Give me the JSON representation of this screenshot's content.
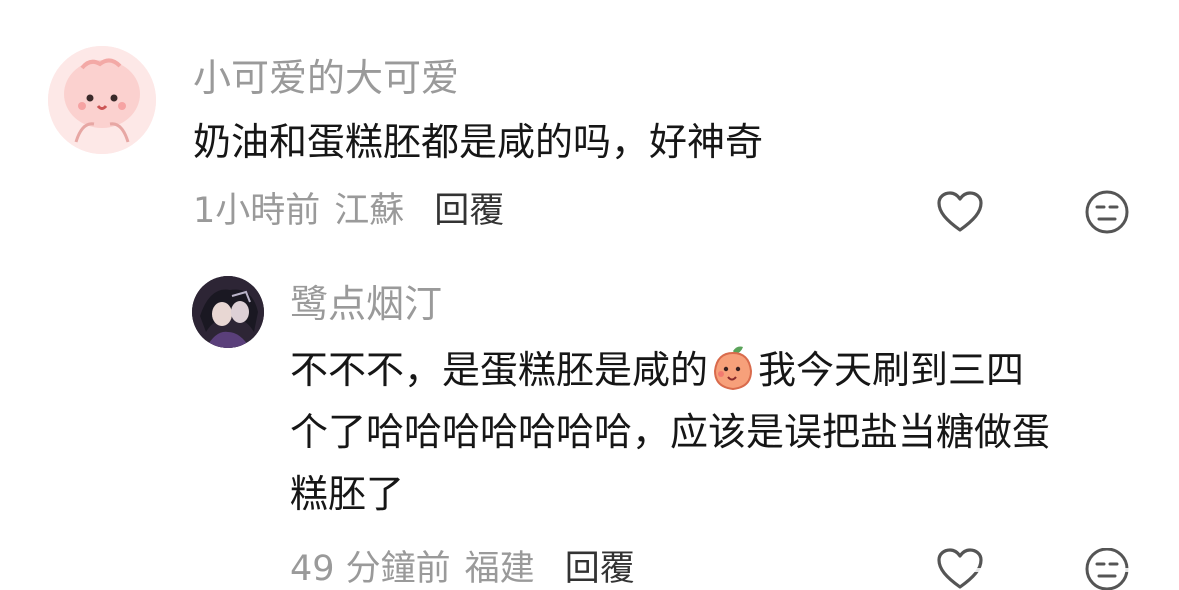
{
  "comments": [
    {
      "username": "小可爱的大可爱",
      "text": "奶油和蛋糕胚都是咸的吗，好神奇",
      "time": "1小時前",
      "location": "江蘇",
      "reply_label": "回覆"
    }
  ],
  "replies": [
    {
      "username": "鹭点烟汀",
      "text_before_emoji": "不不不，是蛋糕胚是咸的",
      "emoji": "peach-emoji",
      "text_after_emoji": "我今天刷到三四",
      "text_line2": "个了哈哈哈哈哈哈哈，应该是误把盐当糖做蛋",
      "text_line3": "糕胚了",
      "time": "49 分鐘前",
      "location": "福建",
      "reply_label": "回覆"
    }
  ],
  "icons": {
    "like": "heart-icon",
    "dislike": "neutral-face-icon"
  },
  "colors": {
    "meta": "#9a9a9a",
    "text": "#161616",
    "background": "#ffffff"
  }
}
